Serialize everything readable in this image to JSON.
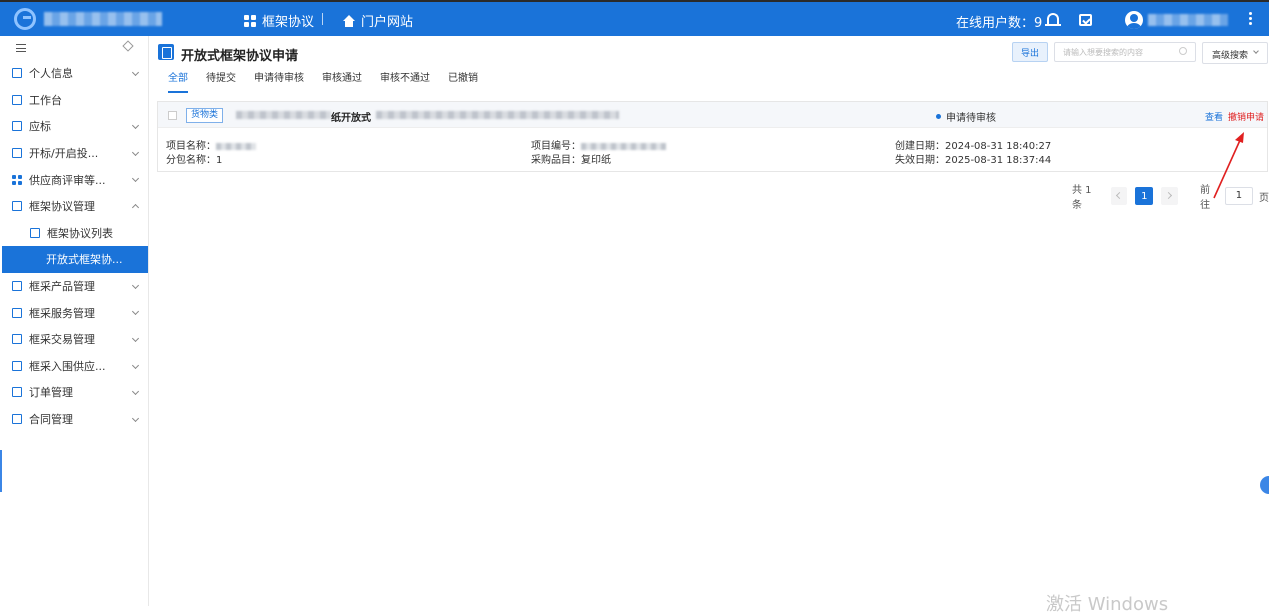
{
  "topbar": {
    "nav_framework": "框架协议",
    "nav_portal": "门户网站",
    "online_users": "在线用户数：9"
  },
  "sidebar": {
    "items": [
      {
        "label": "个人信息",
        "expand": "down"
      },
      {
        "label": "工作台",
        "expand": ""
      },
      {
        "label": "应标",
        "expand": "down"
      },
      {
        "label": "开标/开启投...",
        "expand": "down"
      },
      {
        "label": "供应商评审等...",
        "expand": "down"
      },
      {
        "label": "框架协议管理",
        "expand": "up"
      },
      {
        "label": "框架协议列表",
        "expand": ""
      },
      {
        "label": "开放式框架协...",
        "expand": ""
      },
      {
        "label": "框采产品管理",
        "expand": "down"
      },
      {
        "label": "框采服务管理",
        "expand": "down"
      },
      {
        "label": "框采交易管理",
        "expand": "down"
      },
      {
        "label": "框采入围供应...",
        "expand": "down"
      },
      {
        "label": "订单管理",
        "expand": "down"
      },
      {
        "label": "合同管理",
        "expand": "down"
      }
    ]
  },
  "header": {
    "title": "开放式框架协议申请",
    "export_label": "导出",
    "search_placeholder": "请输入想要搜索的内容",
    "advanced_search": "高级搜索"
  },
  "tabs": [
    "全部",
    "待提交",
    "申请待审核",
    "审核通过",
    "审核不通过",
    "已撤销"
  ],
  "card": {
    "tag": "货物类",
    "name_fragment": "纸开放式",
    "status": "申请待审核",
    "action_view": "查看",
    "action_cancel": "撤销申请",
    "project_name_label": "项目名称：",
    "subpackage_label": "分包名称：",
    "subpackage_value": "1",
    "project_no_label": "项目编号：",
    "category_label": "采购品目：",
    "category_value": "复印纸",
    "created_label": "创建日期：",
    "created_value": "2024-08-31 18:40:27",
    "expire_label": "失效日期：",
    "expire_value": "2025-08-31 18:37:44"
  },
  "pagination": {
    "total": "共 1 条",
    "current_page": "1",
    "goto_label": "前往",
    "goto_value": "1",
    "page_suffix": "页"
  },
  "watermark": "激活 Windows",
  "colors": {
    "primary": "#1a73d9",
    "danger": "#e02020",
    "annotation_arrow": "#e02020"
  }
}
